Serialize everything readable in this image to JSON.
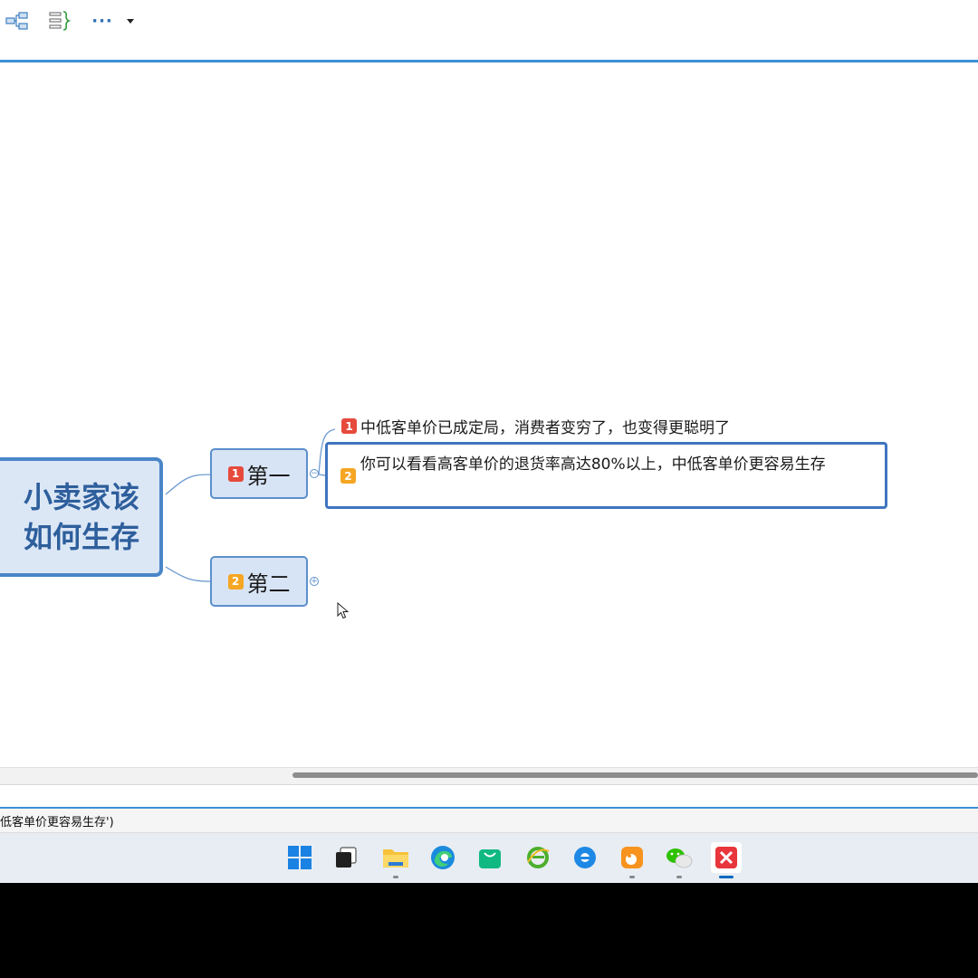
{
  "toolbar": {
    "icons": [
      "mindmap-layout-icon",
      "outline-view-icon",
      "more-icon",
      "dropdown-caret-icon"
    ],
    "more_label": "···"
  },
  "mindmap": {
    "root": {
      "label": "小卖家该\n如何生存"
    },
    "topics": [
      {
        "badge": "1",
        "label": "第一",
        "collapse_symbol": "−",
        "children": [
          {
            "badge": "1",
            "text": "中低客单价已成定局，消费者变穷了，也变得更聪明了"
          },
          {
            "badge": "2",
            "text": "你可以看看高客单价的退货率高达80%以上，中低客单价更容易生存"
          }
        ]
      },
      {
        "badge": "2",
        "label": "第二",
        "collapse_symbol": "+",
        "children": []
      }
    ]
  },
  "status_bar": {
    "text": "低客单价更容易生存')"
  },
  "taskbar": {
    "apps": [
      {
        "name": "start-icon",
        "running": false,
        "active": false
      },
      {
        "name": "task-view-icon",
        "running": false,
        "active": false
      },
      {
        "name": "file-explorer-icon",
        "running": true,
        "active": false
      },
      {
        "name": "edge-icon",
        "running": false,
        "active": false
      },
      {
        "name": "store-icon",
        "running": false,
        "active": false
      },
      {
        "name": "ie-green-icon",
        "running": false,
        "active": false
      },
      {
        "name": "ie-blue-icon",
        "running": false,
        "active": false
      },
      {
        "name": "uc-browser-icon",
        "running": true,
        "active": false
      },
      {
        "name": "wechat-icon",
        "running": true,
        "active": false
      },
      {
        "name": "xmind-icon",
        "running": true,
        "active": true
      }
    ]
  },
  "colors": {
    "accent": "#3d8fd6",
    "node_fill": "#d7e4f5",
    "node_border": "#5b8fcc",
    "root_text": "#2e5f9c",
    "badge_red": "#e64a3c",
    "badge_orange": "#f5a623"
  }
}
